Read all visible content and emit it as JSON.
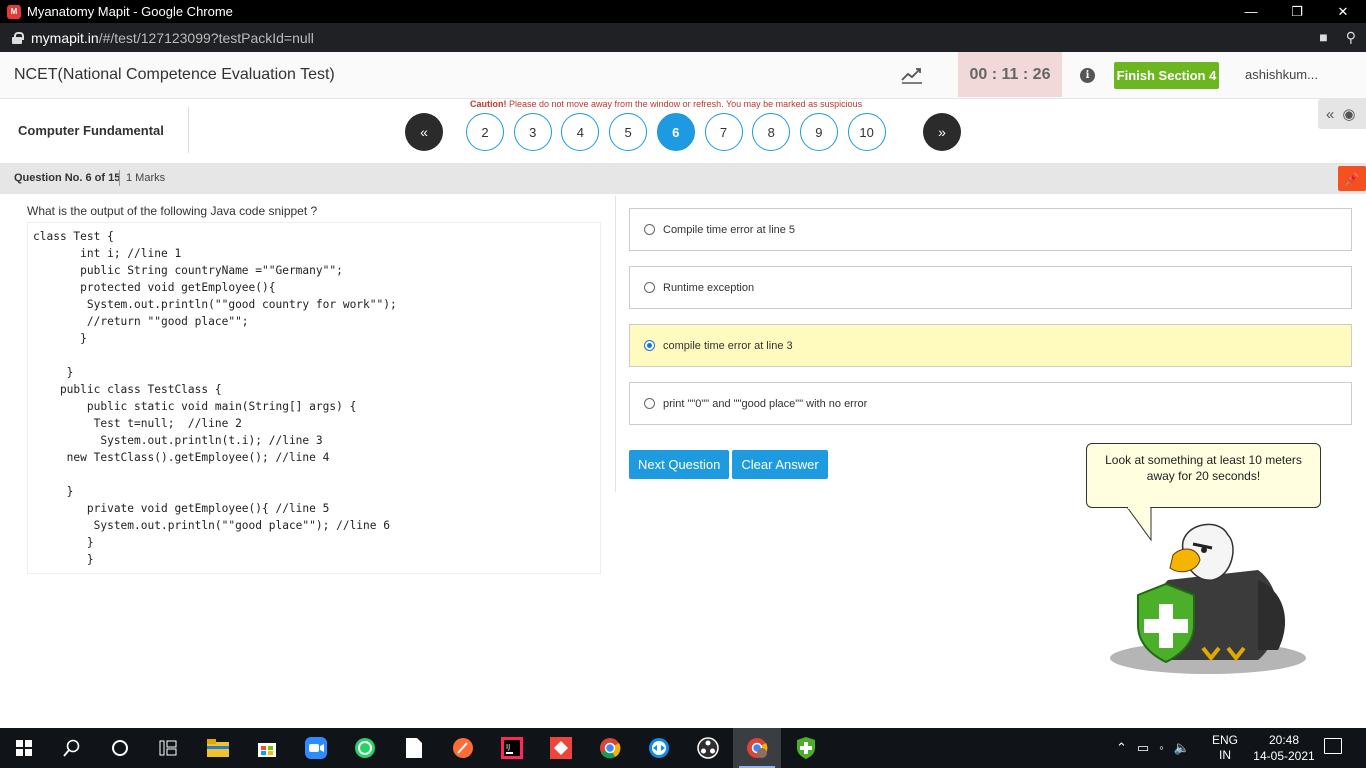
{
  "browser": {
    "window_title": "Myanatomy Mapit - Google Chrome",
    "app_icon_text": "M",
    "url_host": "mymapit.in",
    "url_path": "/#/test/127123099?testPackId=null"
  },
  "header": {
    "test_title": "NCET(National Competence Evaluation Test)",
    "timer": "00 : 11 : 26",
    "finish_label": "Finish Section 4",
    "username": "ashishkum..."
  },
  "nav": {
    "caution_bold": "Caution!",
    "caution_text": " Please do not move away from the window or refresh. You may be marked as suspicious",
    "section_name": "Computer Fundamental",
    "prev_label": "«",
    "next_label": "»",
    "questions": [
      "2",
      "3",
      "4",
      "5",
      "6",
      "7",
      "8",
      "9",
      "10"
    ],
    "active_question": "6"
  },
  "question_bar": {
    "number_label": "Question No. 6 of 15",
    "marks_label": "1 Marks"
  },
  "question": {
    "text": "What is the output of the following Java code snippet ?",
    "code": "class Test {\n       int i; //line 1\n       public String countryName =\"\"Germany\"\";\n       protected void getEmployee(){\n        System.out.println(\"\"good country for work\"\");\n        //return \"\"good place\"\";\n       }\n\n     }\n    public class TestClass {\n        public static void main(String[] args) {\n         Test t=null;  //line 2\n          System.out.println(t.i); //line 3\n     new TestClass().getEmployee(); //line 4\n\n     }\n        private void getEmployee(){ //line 5\n         System.out.println(\"\"good place\"\"); //line 6\n        }\n        }"
  },
  "options": [
    {
      "label": "Compile time error at line 5",
      "selected": false
    },
    {
      "label": "Runtime exception",
      "selected": false
    },
    {
      "label": "compile time error at line 3",
      "selected": true
    },
    {
      "label": "print \"\"0\"\" and \"\"good place\"\" with no error",
      "selected": false
    }
  ],
  "actions": {
    "next_label": "Next Question",
    "clear_label": "Clear Answer"
  },
  "tip": {
    "text": "Look at something at least 10 meters away for 20 seconds!"
  },
  "taskbar": {
    "lang_top": "ENG",
    "lang_bottom": "IN",
    "time": "20:48",
    "date": "14-05-2021"
  },
  "colors": {
    "accent": "#1e9be0",
    "finish": "#6cb61f",
    "selected_option": "#fffbbe",
    "timer_bg": "#f2d9d9"
  }
}
